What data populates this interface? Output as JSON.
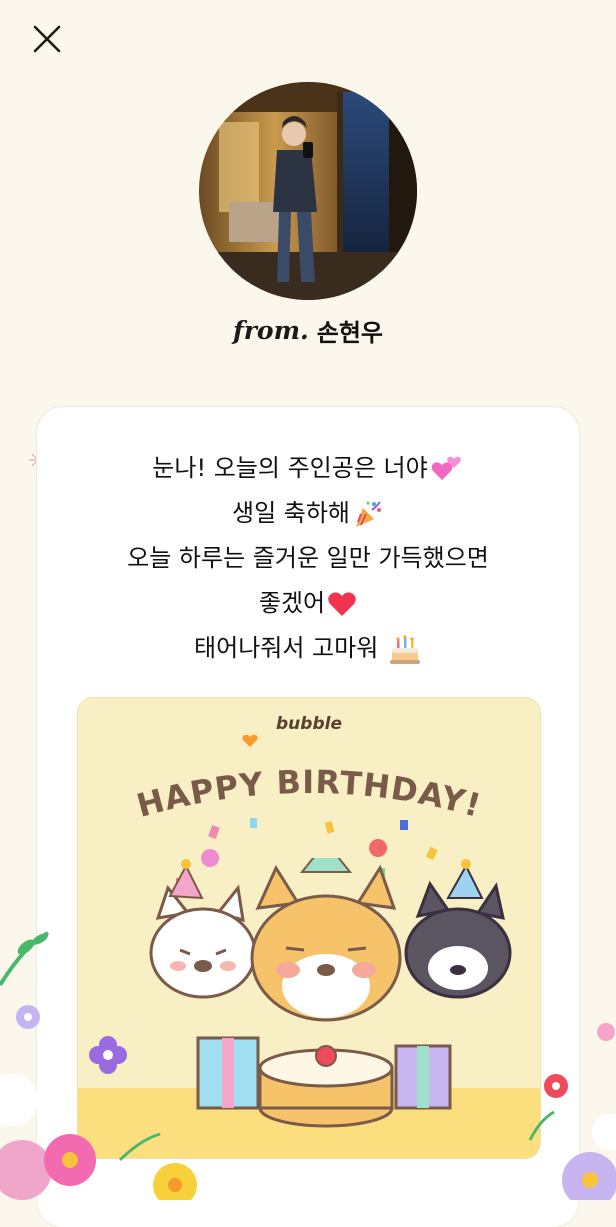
{
  "header": {
    "close_icon": "close-icon"
  },
  "profile": {
    "from_label": "from.",
    "sender_name": "손현우"
  },
  "message": {
    "lines": [
      "눈나! 오늘의 주인공은 너야",
      "생일 축하해",
      "오늘 하루는 즐거운 일만 가득했으면",
      "좋겠어",
      "태어나줘서 고마워"
    ],
    "emojis": [
      "two-hearts",
      "party-popper",
      "red-heart",
      "birthday-cake"
    ]
  },
  "birthday_card": {
    "brand": "bubble",
    "title": "HAPPY BIRTHDAY!"
  },
  "colors": {
    "background": "#fbf7ec",
    "card": "#ffffff",
    "birthday_card_bg": "#f8efc4",
    "title_brown": "#7a5a48"
  }
}
